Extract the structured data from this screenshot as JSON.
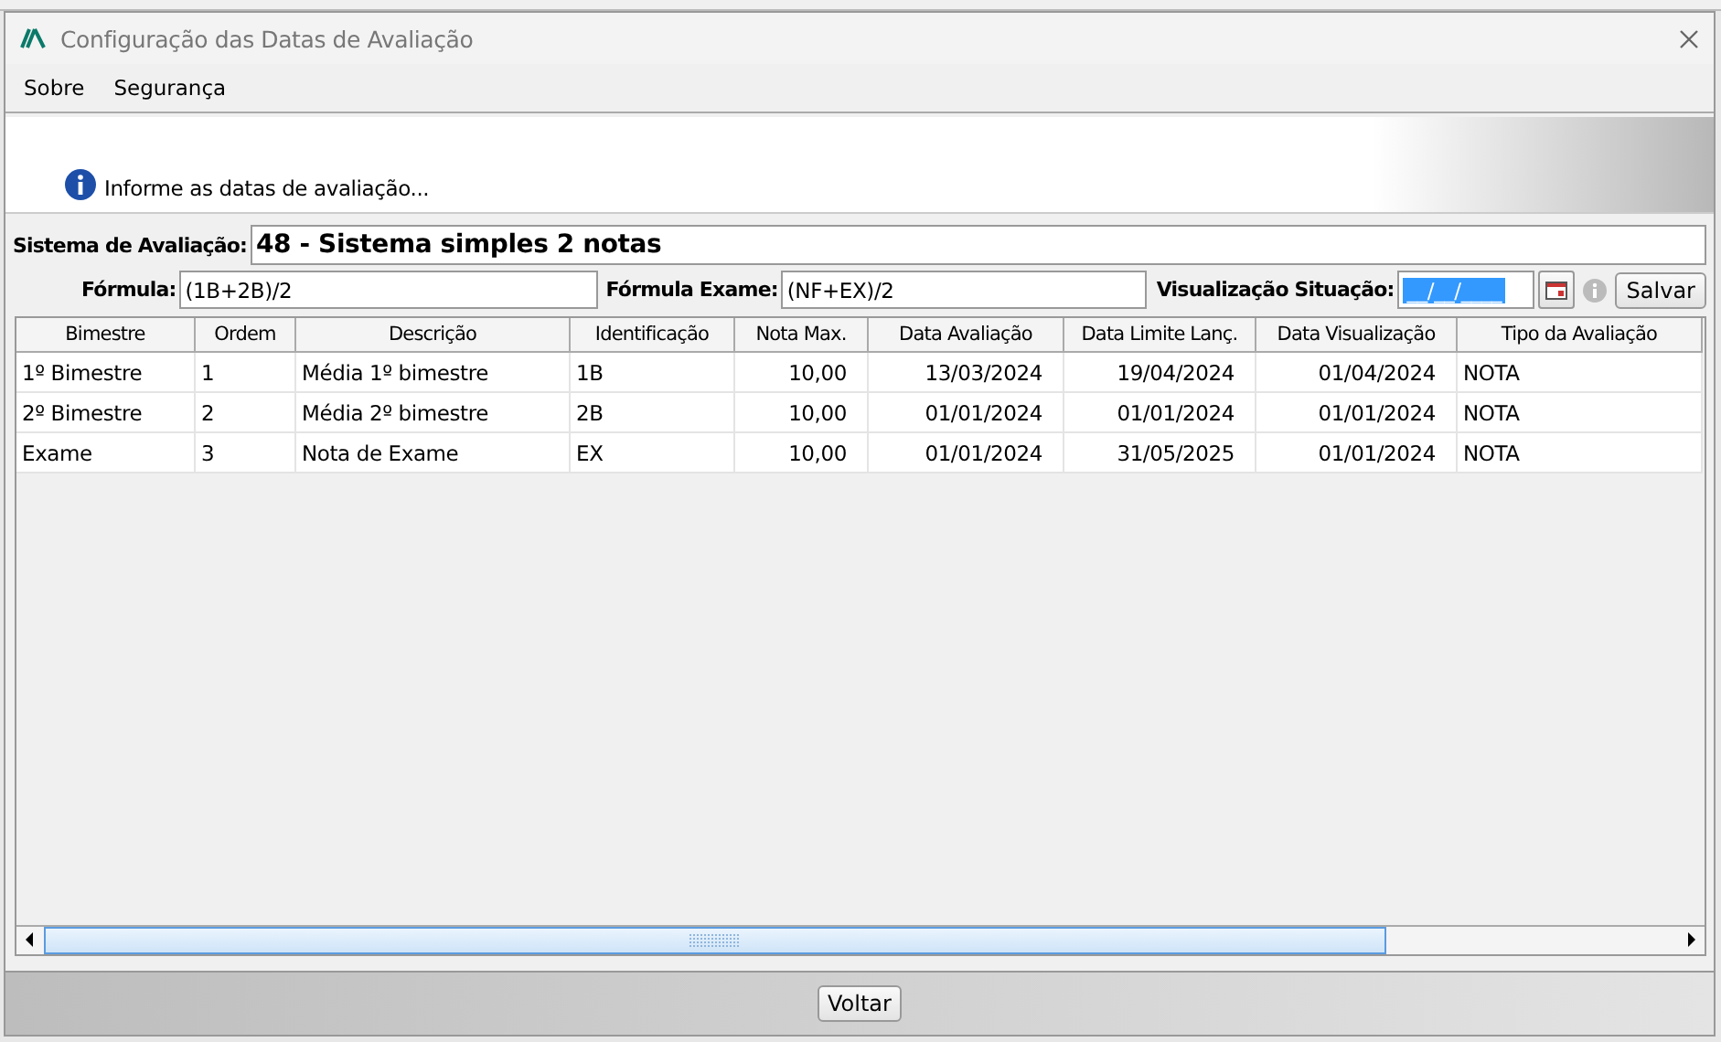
{
  "window": {
    "title": "Configuração das Datas de Avaliação"
  },
  "menu": [
    {
      "label": "Sobre"
    },
    {
      "label": "Segurança"
    }
  ],
  "info": {
    "message": "Informe as datas de avaliação..."
  },
  "form": {
    "sistema_label": "Sistema de Avaliação:",
    "sistema_value": "48 - Sistema simples 2 notas",
    "formula_label": "Fórmula:",
    "formula_value": "(1B+2B)/2",
    "formula_exame_label": "Fórmula Exame:",
    "formula_exame_value": "(NF+EX)/2",
    "visualizacao_label": "Visualização Situação:",
    "visualizacao_value": "__/__/____",
    "visualizacao_selected": true,
    "save_button": "Salvar"
  },
  "table": {
    "columns": [
      "Bimestre",
      "Ordem",
      "Descrição",
      "Identificação",
      "Nota Max.",
      "Data Avaliação",
      "Data Limite Lanç.",
      "Data Visualização",
      "Tipo da Avaliação"
    ],
    "rows": [
      [
        "1º Bimestre",
        "1",
        "Média 1º bimestre",
        "1B",
        "10,00",
        "13/03/2024",
        "19/04/2024",
        "01/04/2024",
        "NOTA"
      ],
      [
        "2º Bimestre",
        "2",
        "Média 2º bimestre",
        "2B",
        "10,00",
        "01/01/2024",
        "01/01/2024",
        "01/01/2024",
        "NOTA"
      ],
      [
        "Exame",
        "3",
        "Nota de Exame",
        "EX",
        "10,00",
        "01/01/2024",
        "31/05/2025",
        "01/01/2024",
        "NOTA"
      ]
    ]
  },
  "footer": {
    "back_button": "Voltar"
  }
}
